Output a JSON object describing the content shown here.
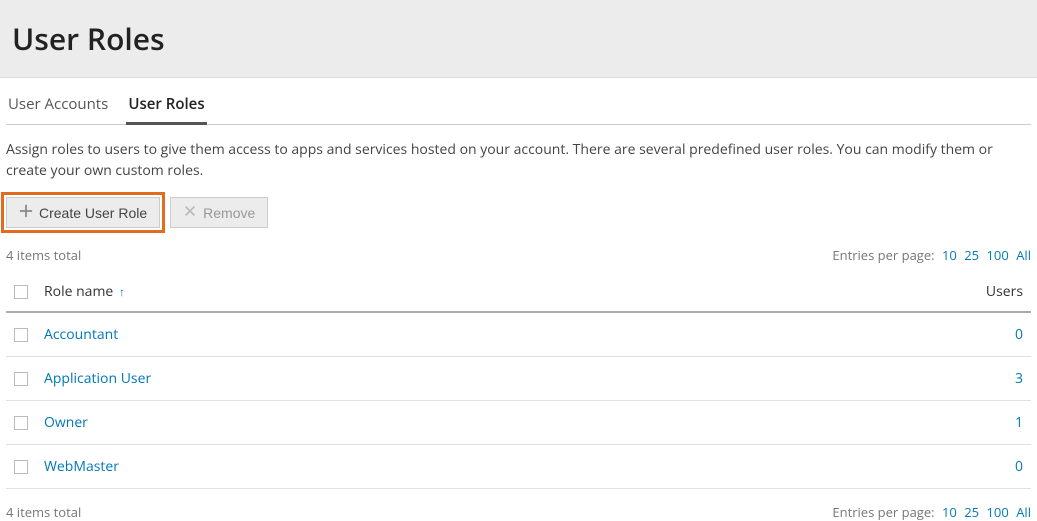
{
  "header": {
    "title": "User Roles"
  },
  "tabs": [
    {
      "label": "User Accounts",
      "active": false
    },
    {
      "label": "User Roles",
      "active": true
    }
  ],
  "description": "Assign roles to users to give them access to apps and services hosted on your account. There are several predefined user roles. You can modify them or create your own custom roles.",
  "toolbar": {
    "create_label": "Create User Role",
    "remove_label": "Remove"
  },
  "list_meta": {
    "total_text": "4 items total",
    "entries_label": "Entries per page:",
    "options": [
      "10",
      "25",
      "100",
      "All"
    ]
  },
  "table": {
    "columns": {
      "role_name": "Role name",
      "users": "Users"
    },
    "rows": [
      {
        "name": "Accountant",
        "users": "0"
      },
      {
        "name": "Application User",
        "users": "3"
      },
      {
        "name": "Owner",
        "users": "1"
      },
      {
        "name": "WebMaster",
        "users": "0"
      }
    ]
  }
}
